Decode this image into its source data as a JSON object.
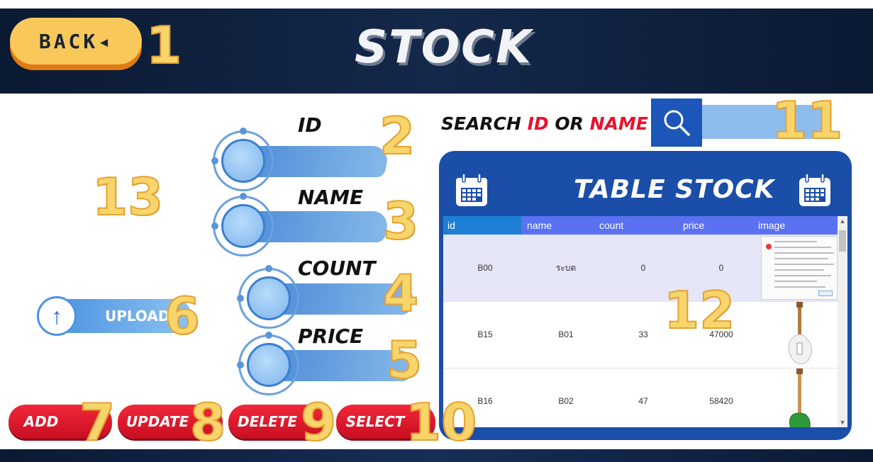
{
  "header": {
    "back_label": "BACK◂",
    "title": "STOCK"
  },
  "form": {
    "id_label": "ID",
    "name_label": "NAME",
    "count_label": "COUNT",
    "price_label": "PRICE",
    "upload_label": "UPLOAD"
  },
  "actions": {
    "add": "ADD",
    "update": "UPDATE",
    "delete": "DELETE",
    "select": "SELECT"
  },
  "search": {
    "label_prefix": "SEARCH ",
    "label_id": "ID",
    "label_or": " OR ",
    "label_name": "NAME",
    "value": ""
  },
  "table": {
    "title": "TABLE STOCK",
    "columns": [
      "id",
      "name",
      "count",
      "price",
      "image"
    ],
    "rows": [
      {
        "id": "B00",
        "name": "ระบต",
        "count": "0",
        "price": "0",
        "image": "error-dialog-screenshot"
      },
      {
        "id": "B15",
        "name": "B01",
        "count": "33",
        "price": "47000",
        "image": "white-electric-guitar"
      },
      {
        "id": "B16",
        "name": "B02",
        "count": "47",
        "price": "58420",
        "image": "green-bass-guitar"
      }
    ]
  },
  "annotations": [
    "1",
    "2",
    "3",
    "4",
    "5",
    "6",
    "7",
    "8",
    "9",
    "10",
    "11",
    "12",
    "13"
  ],
  "colors": {
    "accent_blue": "#1a4ea8",
    "button_red": "#e8122c",
    "back_yellow": "#f9c85a",
    "annotation_gold": "#f7d56c"
  }
}
